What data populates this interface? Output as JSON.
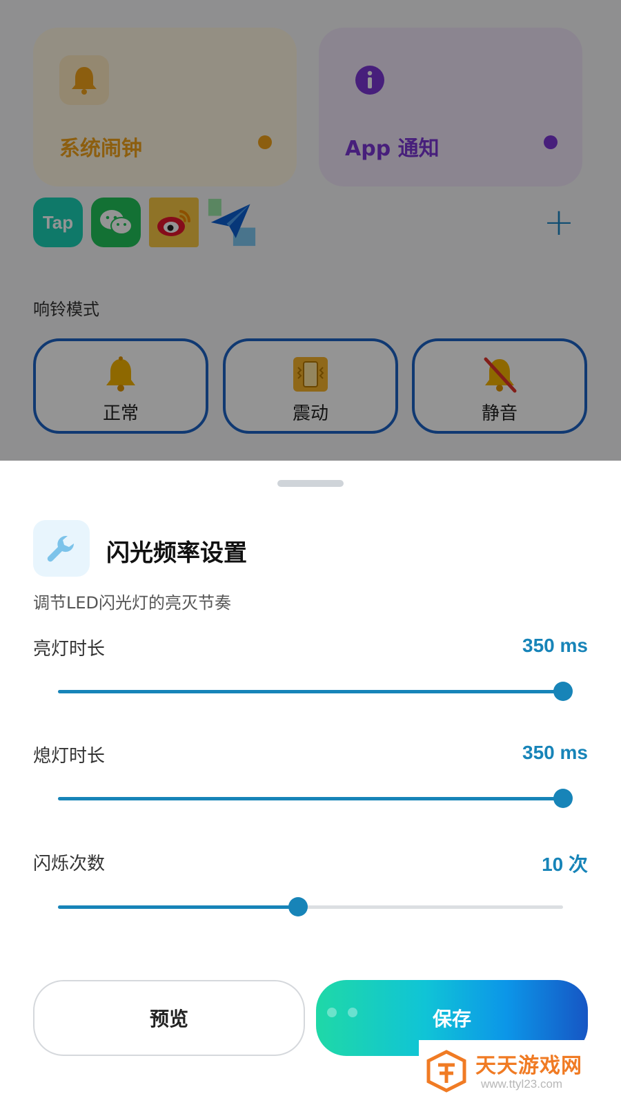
{
  "background": {
    "categories": [
      {
        "key": "alarm",
        "title": "系统闹钟",
        "icon": "bell-icon",
        "color": "#f2a31a"
      },
      {
        "key": "app",
        "title": "App 通知",
        "icon": "info-icon",
        "color": "#7b36d4"
      }
    ],
    "apps": [
      {
        "key": "tap",
        "label": "Tap",
        "icon": "taptap-app-icon"
      },
      {
        "key": "wechat",
        "icon": "wechat-app-icon"
      },
      {
        "key": "weibo",
        "icon": "weibo-app-icon"
      },
      {
        "key": "paper",
        "icon": "paper-plane-app-icon"
      }
    ],
    "add_label": "+",
    "ring_mode_label": "响铃模式",
    "ring_modes": [
      {
        "key": "normal",
        "label": "正常",
        "icon": "bell-icon"
      },
      {
        "key": "vibrate",
        "label": "震动",
        "icon": "vibrate-icon"
      },
      {
        "key": "silent",
        "label": "静音",
        "icon": "bell-muted-icon"
      }
    ]
  },
  "sheet": {
    "title": "闪光频率设置",
    "subtitle": "调节LED闪光灯的亮灭节奏",
    "icon": "wrench-icon",
    "settings": [
      {
        "key": "on",
        "label": "亮灯时长",
        "value_text": "350 ms",
        "level": 1.0
      },
      {
        "key": "off",
        "label": "熄灯时长",
        "value_text": "350 ms",
        "level": 1.0
      },
      {
        "key": "count",
        "label": "闪烁次数",
        "value_text": "10 次",
        "level": 0.475
      }
    ],
    "preview_label": "预览",
    "save_label": "保存",
    "accent_color": "#1784b8"
  },
  "watermark": {
    "name": "天天游戏网",
    "url": "www.ttyl23.com"
  }
}
